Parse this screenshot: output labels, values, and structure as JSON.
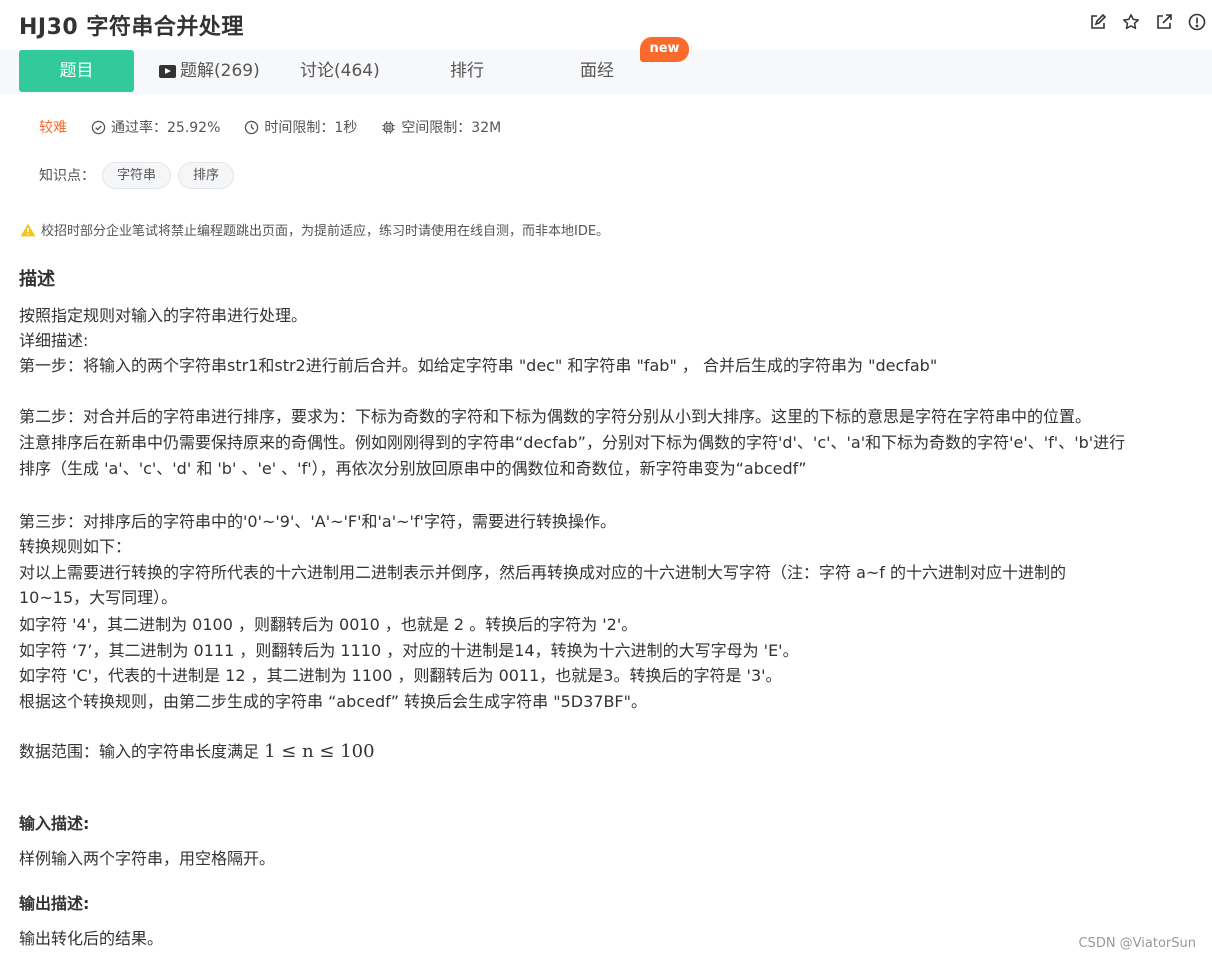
{
  "header": {
    "title": "HJ30  字符串合并处理",
    "icons": [
      "edit-icon",
      "star-icon",
      "share-icon",
      "report-icon"
    ]
  },
  "tabs": {
    "problem": "题目",
    "solutions": "题解(269)",
    "discussion": "讨论(464)",
    "ranking": "排行",
    "interview": "面经",
    "new_badge": "new"
  },
  "meta": {
    "difficulty": "较难",
    "pass_rate": "通过率：25.92%",
    "time_limit": "时间限制：1秒",
    "space_limit": "空间限制：32M"
  },
  "knowledge": {
    "label": "知识点：",
    "tags": [
      "字符串",
      "排序"
    ]
  },
  "warning": "校招时部分企业笔试将禁止编程题跳出页面，为提前适应，练习时请使用在线自测，而非本地IDE。",
  "description": {
    "heading": "描述",
    "lines": [
      "按照指定规则对输入的字符串进行处理。",
      "详细描述:",
      "第一步：将输入的两个字符串str1和str2进行前后合并。如给定字符串 \"dec\" 和字符串 \"fab\" ， 合并后生成的字符串为 \"decfab\"",
      "第二步：对合并后的字符串进行排序，要求为：下标为奇数的字符和下标为偶数的字符分别从小到大排序。这里的下标的意思是字符在字符串中的位置。",
      "注意排序后在新串中仍需要保持原来的奇偶性。例如刚刚得到的字符串“decfab”，分别对下标为偶数的字符'd'、'c'、'a'和下标为奇数的字符'e'、'f'、'b'进行",
      "排序（生成 'a'、'c'、'd' 和 'b' 、'e' 、'f'），再依次分别放回原串中的偶数位和奇数位，新字符串变为“abcedf”",
      "第三步：对排序后的字符串中的'0'~'9'、'A'~'F'和'a'~'f'字符，需要进行转换操作。",
      "转换规则如下：",
      "对以上需要进行转换的字符所代表的十六进制用二进制表示并倒序，然后再转换成对应的十六进制大写字符（注：字符 a~f 的十六进制对应十进制的",
      "10~15，大写同理）。",
      "如字符 '4'，其二进制为 0100 ，则翻转后为 0010 ，也就是 2 。转换后的字符为 '2'。",
      "如字符 ‘7’，其二进制为 0111 ，则翻转后为 1110 ，对应的十进制是14，转换为十六进制的大写字母为 'E'。",
      "如字符 'C'，代表的十进制是 12 ，其二进制为 1100 ，则翻转后为 0011，也就是3。转换后的字符是 '3'。",
      "根据这个转换规则，由第二步生成的字符串 “abcedf” 转换后会生成字符串 \"5D37BF\"。"
    ],
    "range_prefix": "数据范围：输入的字符串长度满足 ",
    "range_math": "1 ≤ n ≤ 100"
  },
  "input_desc": {
    "heading": "输入描述:",
    "text": "样例输入两个字符串，用空格隔开。"
  },
  "output_desc": {
    "heading": "输出描述:",
    "text": "输出转化后的结果。"
  },
  "footer": {
    "credit": "CSDN @ViatorSun"
  },
  "colors": {
    "accent": "#32ca99",
    "badge": "#fa6a2c",
    "difficulty": "#fa6a2c",
    "warning": "#f5c518"
  }
}
